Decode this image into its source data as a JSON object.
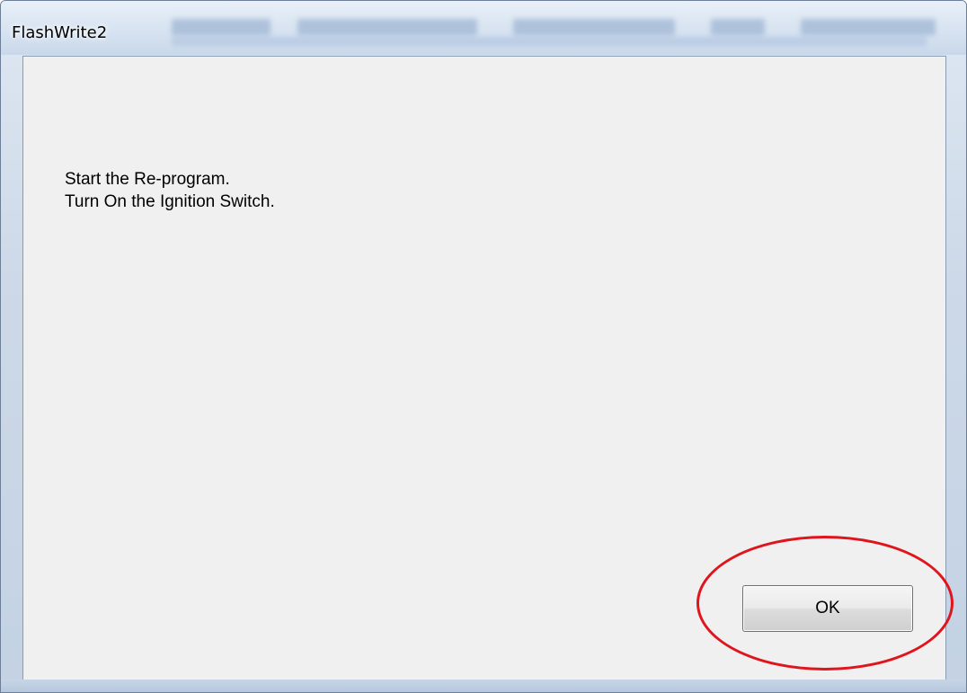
{
  "window": {
    "title": "FlashWrite2"
  },
  "dialog": {
    "message_lines": [
      "Start the Re-program.",
      "Turn On the Ignition Switch."
    ],
    "ok_label": "OK"
  },
  "annotation": {
    "highlight_color": "#e0141d"
  }
}
